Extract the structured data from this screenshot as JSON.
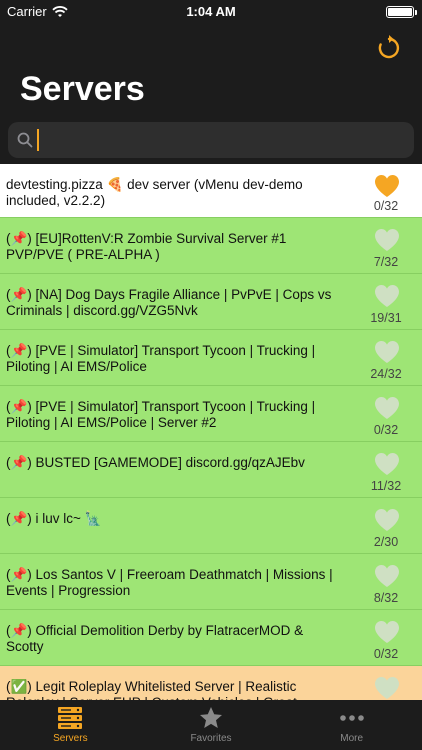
{
  "status_bar": {
    "carrier": "Carrier",
    "time": "1:04 AM"
  },
  "header": {
    "title": "Servers"
  },
  "search": {
    "placeholder": "",
    "value": ""
  },
  "colors": {
    "accent": "#f5a623",
    "row_green": "#9ee575",
    "row_white": "#ffffff",
    "row_orange": "#fbd49a",
    "heart_inactive": "#cfe0c3"
  },
  "servers": [
    {
      "name": "devtesting.pizza 🍕 dev server (vMenu dev-demo included, v2.2.2)",
      "count": "0/32",
      "favorite": true
    },
    {
      "name": "(📌) [EU]RottenV:R Zombie Survival Server #1 PVP/PVE ( PRE-ALPHA )",
      "count": "7/32",
      "favorite": false
    },
    {
      "name": "(📌) [NA] Dog Days Fragile Alliance | PvPvE | Cops vs Criminals | discord.gg/VZG5Nvk",
      "count": "19/31",
      "favorite": false
    },
    {
      "name": "(📌) [PVE | Simulator] Transport Tycoon | Trucking | Piloting | AI EMS/Police",
      "count": "24/32",
      "favorite": false
    },
    {
      "name": "(📌) [PVE | Simulator] Transport Tycoon | Trucking | Piloting | AI EMS/Police | Server #2",
      "count": "0/32",
      "favorite": false
    },
    {
      "name": "(📌) BUSTED [GAMEMODE] discord.gg/qzAJEbv",
      "count": "11/32",
      "favorite": false
    },
    {
      "name": "(📌) i luv lc~ 🗽",
      "count": "2/30",
      "favorite": false
    },
    {
      "name": "(📌) Los Santos V | Freeroam Deathmatch | Missions | Events | Progression",
      "count": "8/32",
      "favorite": false
    },
    {
      "name": "(📌) Official Demolition Derby by FlatracerMOD & Scotty",
      "count": "0/32",
      "favorite": false
    },
    {
      "name": "(✅) Legit Roleplay Whitelisted Server | Realistic Roleplay | Server EUP | Custom Vehicles | Great Members and",
      "count": "",
      "favorite": false
    }
  ],
  "tabs": [
    {
      "label": "Servers",
      "icon": "server-icon",
      "active": true
    },
    {
      "label": "Favorites",
      "icon": "star-icon",
      "active": false
    },
    {
      "label": "More",
      "icon": "more-icon",
      "active": false
    }
  ]
}
